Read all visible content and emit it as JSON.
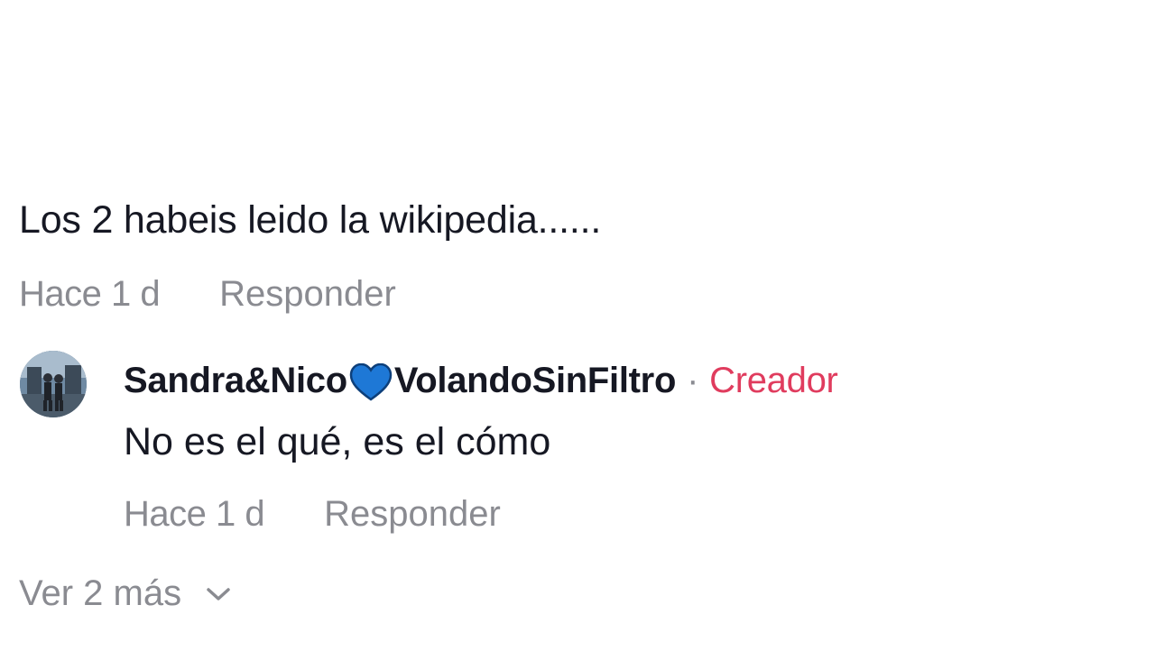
{
  "comment": {
    "text": "Los 2 habeis leido la wikipedia......",
    "time": "Hace 1 d",
    "reply_label": "Responder"
  },
  "reply": {
    "author_first": "Sandra&Nico",
    "author_emoji": "blue-heart-icon",
    "author_second": "VolandoSinFiltro",
    "separator": "·",
    "badge": "Creador",
    "text": "No es el qué, es el cómo",
    "time": "Hace 1 d",
    "reply_label": "Responder"
  },
  "more_replies": {
    "label": "Ver 2 más",
    "icon": "chevron-down-icon"
  },
  "colors": {
    "text": "#161823",
    "muted": "#8a8b91",
    "creator_badge": "#e03c5e",
    "heart": "#1e78d6"
  }
}
